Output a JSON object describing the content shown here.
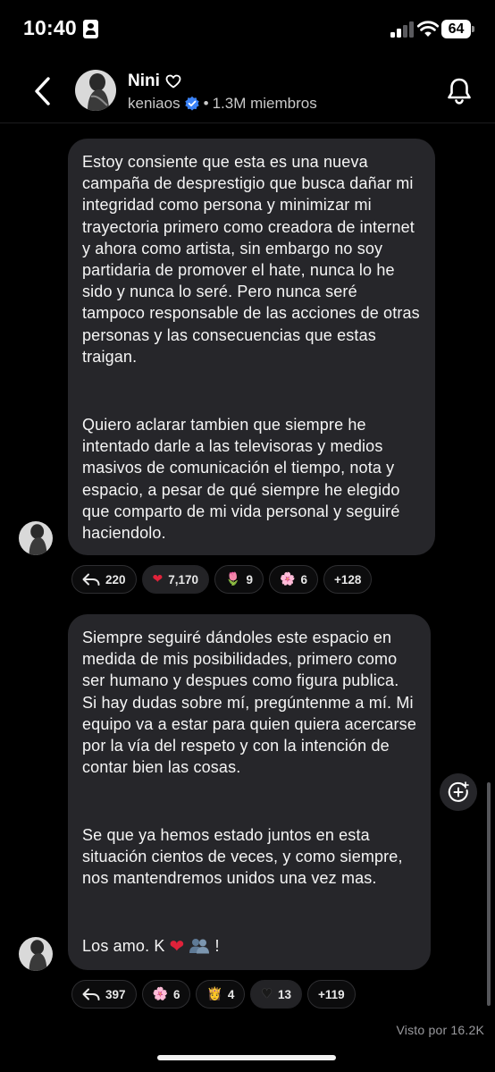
{
  "status_bar": {
    "time": "10:40",
    "battery": "64"
  },
  "header": {
    "channel_name": "Nini",
    "handle": "keniaos",
    "separator": "•",
    "members": "1.3M miembros"
  },
  "messages": [
    {
      "paragraphs": [
        "Estoy consiente que esta es una nueva campaña de desprestigio que busca dañar mi integridad como persona y minimizar mi trayectoria primero como creadora de internet y ahora como artista, sin embargo no soy partidaria de promover el hate, nunca lo he sido y nunca lo seré. Pero nunca seré tampoco responsable de las acciones de otras personas y las consecuencias que estas traigan.",
        "Quiero aclarar tambien que siempre he intentado darle a las televisoras y medios masivos de comunicación el tiempo, nota y espacio, a pesar de qué siempre he elegido que comparto de mi vida personal y seguiré haciendolo."
      ],
      "reactions": [
        {
          "icon": "reply-icon",
          "count": "220"
        },
        {
          "emoji": "❤",
          "icon": "red-heart-icon",
          "count": "7,170",
          "active": true
        },
        {
          "emoji": "🌷",
          "icon": "tulip-icon",
          "count": "9"
        },
        {
          "emoji": "🌸",
          "icon": "cherry-blossom-icon",
          "count": "6"
        },
        {
          "more": "+128"
        }
      ]
    },
    {
      "paragraphs": [
        "Siempre seguiré dándoles este espacio en medida de mis posibilidades, primero como ser humano y despues como figura publica. Si hay dudas sobre mí, pregúntenme a mí. Mi equipo va a estar para quien quiera acercarse por la vía del respeto y con la intención de contar bien las cosas.",
        "Se que ya hemos estado juntos en esta situación cientos de veces, y como siempre, nos mantendremos unidos una vez mas.",
        "Los amo. K",
        "!"
      ],
      "reactions": [
        {
          "icon": "reply-icon",
          "count": "397"
        },
        {
          "emoji": "🌸",
          "icon": "cherry-blossom-icon",
          "count": "6"
        },
        {
          "emoji": "👸",
          "icon": "princess-icon",
          "count": "4"
        },
        {
          "emoji": "♥",
          "icon": "black-heart-icon",
          "count": "13",
          "active": true
        },
        {
          "more": "+119"
        }
      ]
    }
  ],
  "seen_by": "Visto por 16.2K"
}
